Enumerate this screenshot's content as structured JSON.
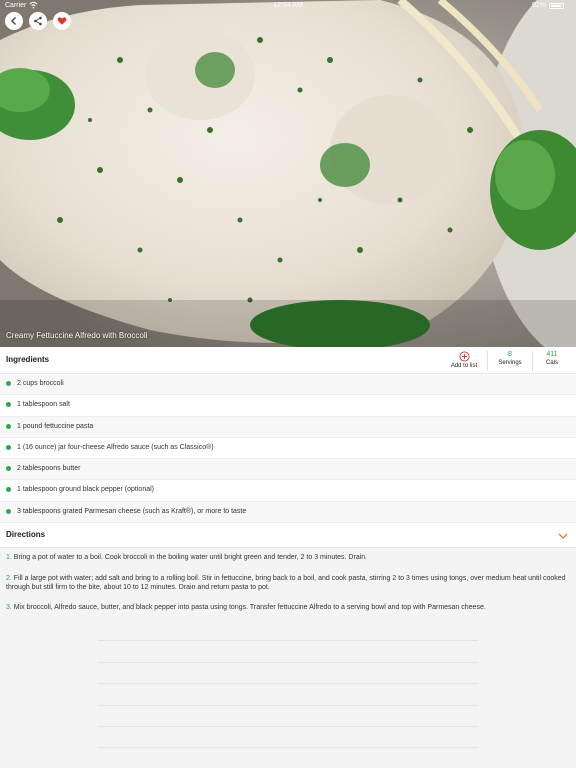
{
  "status_bar": {
    "carrier": "Carrier",
    "time": "12:24 AM",
    "battery": "92%"
  },
  "hero": {
    "caption": "Creamy Fettuccine Alfredo with Broccoli",
    "buttons": [
      "back-icon",
      "share-icon",
      "heart-icon"
    ]
  },
  "ingredients_section": {
    "title": "Ingredients",
    "add_to_list_label": "Add to list",
    "servings_value": "8",
    "servings_label": "Servings",
    "cals_value": "411",
    "cals_label": "Cals",
    "items": [
      "2 cups broccoli",
      "1 tablespoon salt",
      "1 pound fettuccine pasta",
      "1 (16 ounce) jar four-cheese Alfredo sauce (such as Classico®)",
      "2 tablespoons butter",
      "1 tablespoon ground black pepper (optional)",
      "3 tablespoons grated Parmesan cheese (such as Kraft®), or more to taste"
    ]
  },
  "directions_section": {
    "title": "Directions",
    "steps": [
      {
        "num": "1.",
        "text": "Bring a pot of water to a boil. Cook broccoli in the boiling water until bright green and tender, 2 to 3 minutes. Drain."
      },
      {
        "num": "2.",
        "text": "Fill a large pot with water; add salt and bring to a rolling boil. Stir in fettuccine, bring back to a boil, and cook pasta, stirring 2 to 3 times using tongs, over medium heat until cooked through but still firm to the bite, about 10 to 12 minutes. Drain and return pasta to pot."
      },
      {
        "num": "3.",
        "text": "Mix broccoli, Alfredo sauce, butter, and black pepper into pasta using tongs. Transfer fettuccine Alfredo to a serving bowl and top with Parmesan cheese."
      }
    ]
  },
  "colors": {
    "accent_green": "#2aa84a",
    "heart_red": "#e0342b",
    "chevron_orange": "#e07a2b"
  }
}
